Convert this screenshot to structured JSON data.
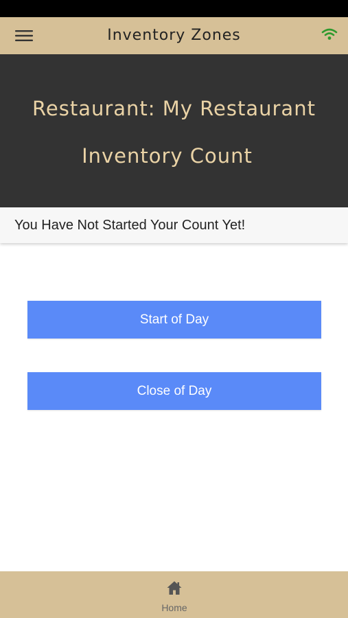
{
  "header": {
    "title": "Inventory Zones",
    "menu_icon": "hamburger-menu-icon",
    "connectivity_icon": "wifi-icon",
    "connectivity_color": "#2e9a2e"
  },
  "hero": {
    "restaurant_line": "Restaurant: My Restaurant",
    "subtitle": "Inventory Count"
  },
  "status": {
    "message": "You Have Not Started Your Count Yet!"
  },
  "actions": {
    "start_label": "Start of Day",
    "close_label": "Close of Day",
    "button_color": "#5a8af8"
  },
  "tab_bar": {
    "items": [
      {
        "label": "Home",
        "icon": "home-icon"
      }
    ]
  },
  "colors": {
    "header_bg": "#d6c097",
    "hero_bg": "#333333",
    "hero_text": "#ead3a6"
  }
}
